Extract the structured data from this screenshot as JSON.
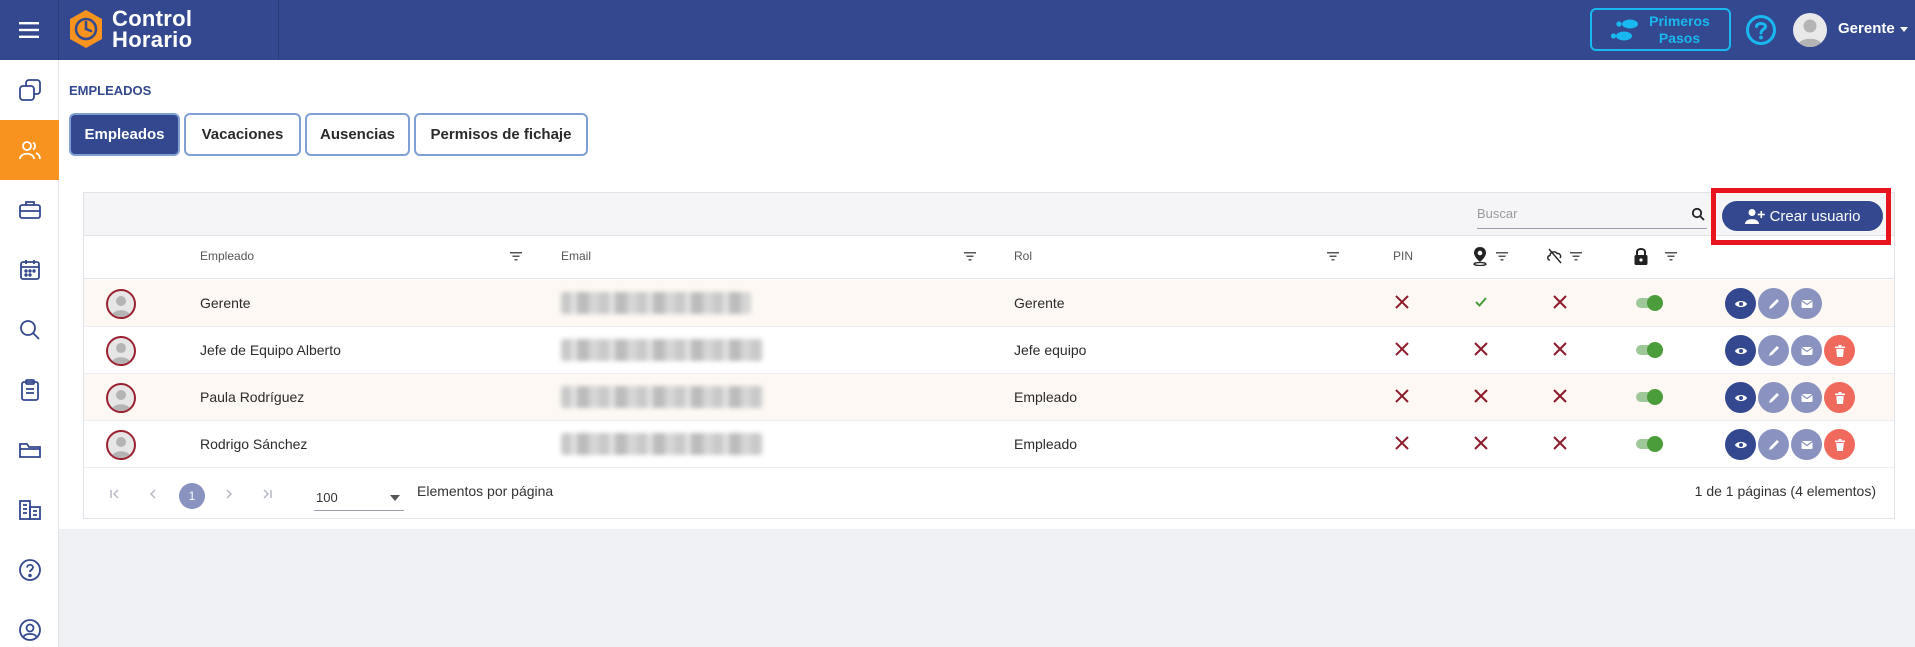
{
  "brand": {
    "line1": "Control",
    "line2": "Horario"
  },
  "header": {
    "first_steps_line1": "Primeros",
    "first_steps_line2": "Pasos",
    "user_name": "Gerente"
  },
  "sidebar": {
    "items": [
      {
        "icon": "copy-icon",
        "active": false
      },
      {
        "icon": "users-icon",
        "active": true
      },
      {
        "icon": "briefcase-icon",
        "active": false
      },
      {
        "icon": "calendar-icon",
        "active": false
      },
      {
        "icon": "search-icon",
        "active": false
      },
      {
        "icon": "clipboard-icon",
        "active": false
      },
      {
        "icon": "folder-icon",
        "active": false
      },
      {
        "icon": "buildings-icon",
        "active": false
      },
      {
        "icon": "help-icon",
        "active": false
      },
      {
        "icon": "user-circle-icon",
        "active": false
      }
    ]
  },
  "page": {
    "section_title": "EMPLEADOS",
    "tabs": [
      {
        "label": "Empleados",
        "active": true
      },
      {
        "label": "Vacaciones",
        "active": false
      },
      {
        "label": "Ausencias",
        "active": false
      },
      {
        "label": "Permisos de fichaje",
        "active": false
      }
    ]
  },
  "toolbar": {
    "search_placeholder": "Buscar",
    "create_label": "Crear usuario"
  },
  "table": {
    "columns": {
      "employee": "Empleado",
      "email": "Email",
      "role": "Rol",
      "pin": "PIN",
      "geo_icon": "location-pin-icon",
      "absence_icon": "cloud-off-icon",
      "lock_icon": "lock-icon"
    },
    "rows": [
      {
        "name": "Gerente",
        "role": "Gerente",
        "pin": false,
        "geo": true,
        "absence": false,
        "active": true,
        "deletable": false
      },
      {
        "name": "Jefe de Equipo Alberto",
        "role": "Jefe equipo",
        "pin": false,
        "geo": false,
        "absence": false,
        "active": true,
        "deletable": true
      },
      {
        "name": "Paula Rodríguez",
        "role": "Empleado",
        "pin": false,
        "geo": false,
        "absence": false,
        "active": true,
        "deletable": true
      },
      {
        "name": "Rodrigo Sánchez",
        "role": "Empleado",
        "pin": false,
        "geo": false,
        "absence": false,
        "active": true,
        "deletable": true
      }
    ]
  },
  "pager": {
    "current_page": "1",
    "page_size": "100",
    "page_size_label": "Elementos por página",
    "info": "1 de 1 páginas (4 elementos)"
  },
  "colors": {
    "primary": "#33488e",
    "accent": "#f7931e",
    "highlight": "#e8141d",
    "info": "#19b8f0"
  }
}
